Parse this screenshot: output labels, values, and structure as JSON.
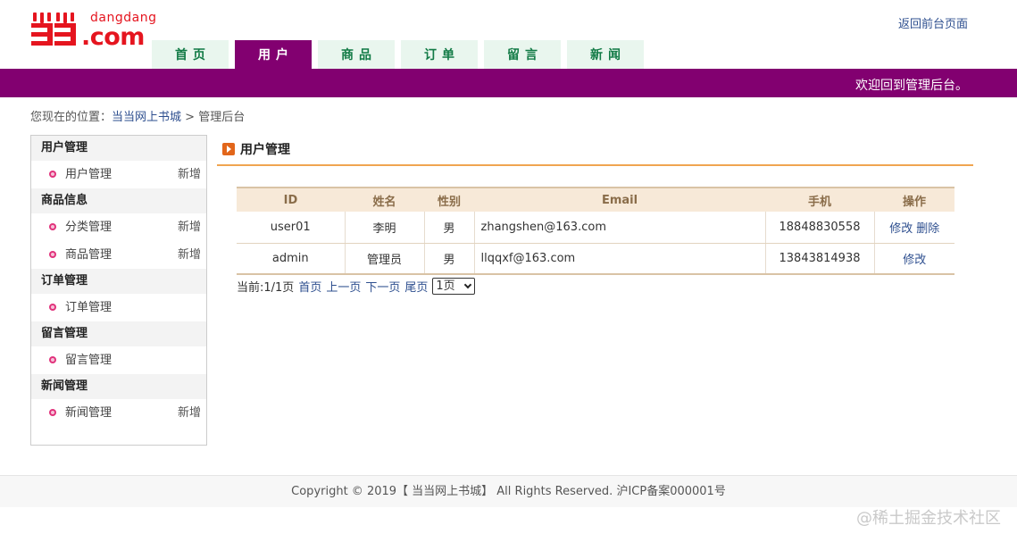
{
  "logo": {
    "small": "dangdang",
    "big": ".com"
  },
  "header": {
    "back_link": "返回前台页面",
    "welcome": "欢迎回到管理后台。"
  },
  "nav": {
    "tabs": [
      "首页",
      "用户",
      "商品",
      "订单",
      "留言",
      "新闻"
    ],
    "active_index": 1
  },
  "breadcrumb": {
    "prefix": "您现在的位置：",
    "link": "当当网上书城",
    "separator": " > ",
    "current": "管理后台"
  },
  "sidebar": {
    "groups": [
      {
        "title": "用户管理",
        "items": [
          {
            "label": "用户管理",
            "add": "新增"
          }
        ]
      },
      {
        "title": "商品信息",
        "items": [
          {
            "label": "分类管理",
            "add": "新增"
          },
          {
            "label": "商品管理",
            "add": "新增"
          }
        ]
      },
      {
        "title": "订单管理",
        "items": [
          {
            "label": "订单管理",
            "add": ""
          }
        ]
      },
      {
        "title": "留言管理",
        "items": [
          {
            "label": "留言管理",
            "add": ""
          }
        ]
      },
      {
        "title": "新闻管理",
        "items": [
          {
            "label": "新闻管理",
            "add": "新增"
          }
        ]
      }
    ]
  },
  "main": {
    "title": "用户管理",
    "table": {
      "headers": [
        "ID",
        "姓名",
        "性别",
        "Email",
        "手机",
        "操作"
      ],
      "rows": [
        {
          "id": "user01",
          "name": "李明",
          "gender": "男",
          "email": "zhangshen@163.com",
          "phone": "18848830558",
          "actions": [
            "修改",
            "删除"
          ]
        },
        {
          "id": "admin",
          "name": "管理员",
          "gender": "男",
          "email": "llqqxf@163.com",
          "phone": "13843814938",
          "actions": [
            "修改"
          ]
        }
      ]
    },
    "pager": {
      "info": "当前:1/1页",
      "first": "首页",
      "prev": "上一页",
      "next": "下一页",
      "last": "尾页",
      "select_value": "1页"
    }
  },
  "footer": {
    "text": "Copyright © 2019【 当当网上书城】 All Rights Reserved. 沪ICP备案000001号"
  },
  "watermark": "@稀土掘金技术社区",
  "colors": {
    "brand_purple": "#820070",
    "nav_green_bg": "#e9f6ee",
    "nav_green_text": "#117a45",
    "logo_red": "#e5151f",
    "accent_orange": "#f0a550"
  }
}
